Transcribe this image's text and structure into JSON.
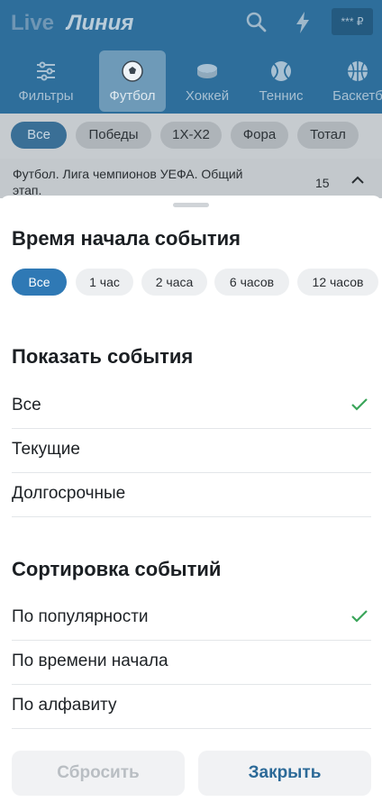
{
  "header": {
    "live_label": "Live",
    "line_label": "Линия",
    "balance": "*** ₽"
  },
  "sports": [
    {
      "label": "Фильтры",
      "icon": "sliders-icon"
    },
    {
      "label": "Футбол",
      "icon": "soccer-ball-icon",
      "active": true
    },
    {
      "label": "Хоккей",
      "icon": "hockey-puck-icon"
    },
    {
      "label": "Теннис",
      "icon": "tennis-ball-icon"
    },
    {
      "label": "Баскетб",
      "icon": "basketball-icon"
    }
  ],
  "market_filters": [
    "Все",
    "Победы",
    "1X-X2",
    "Фора",
    "Тотал"
  ],
  "league": {
    "title": "Футбол. Лига чемпионов УЕФА. Общий этап.",
    "count": "15"
  },
  "sheet": {
    "time_title": "Время начала события",
    "time_chips": [
      "Все",
      "1 час",
      "2 часа",
      "6 часов",
      "12 часов"
    ],
    "show_title": "Показать события",
    "show_options": [
      {
        "label": "Все",
        "checked": true
      },
      {
        "label": "Текущие",
        "checked": false
      },
      {
        "label": "Долгосрочные",
        "checked": false
      }
    ],
    "sort_title": "Сортировка событий",
    "sort_options": [
      {
        "label": "По популярности",
        "checked": true
      },
      {
        "label": "По времени начала",
        "checked": false
      },
      {
        "label": "По алфавиту",
        "checked": false
      }
    ],
    "reset_label": "Сбросить",
    "close_label": "Закрыть"
  },
  "colors": {
    "accent": "#2f79b5",
    "check": "#3aa55a",
    "header_bg": "#2e6e9b"
  }
}
